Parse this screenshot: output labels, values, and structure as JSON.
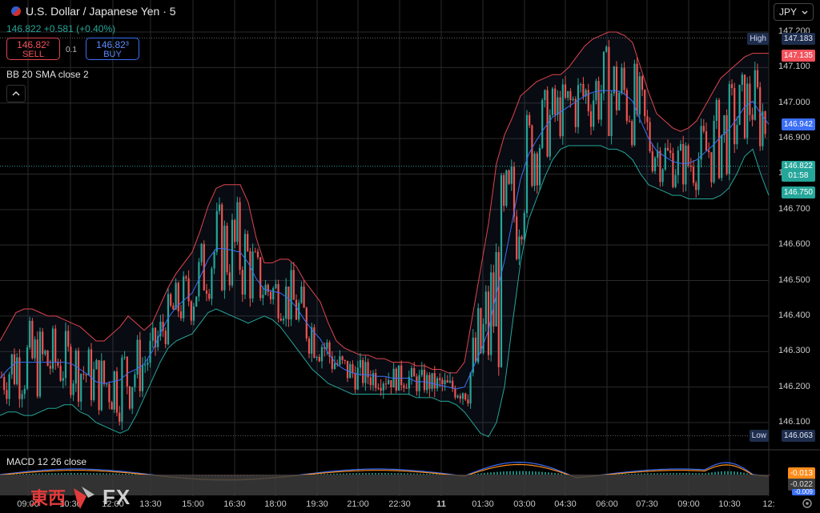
{
  "header": {
    "title": "U.S. Dollar / Japanese Yen · 5",
    "price_change": "146.822 +0.581 (+0.40%)"
  },
  "trade": {
    "sell_price": "146.82²",
    "sell_label": "SELL",
    "spread": "0.1",
    "buy_price": "146.82³",
    "buy_label": "BUY"
  },
  "indicators": {
    "bb_label": "BB 20 SMA close 2",
    "macd_label": "MACD 12 26 close"
  },
  "currency_button": {
    "label": "JPY"
  },
  "price_axis": {
    "ticks": [
      "147.200",
      "147.100",
      "147.000",
      "146.900",
      "146.800",
      "146.700",
      "146.600",
      "146.500",
      "146.400",
      "146.300",
      "146.200",
      "146.100"
    ],
    "high_label": "High",
    "high_value": "147.183",
    "low_label": "Low",
    "low_value": "146.063",
    "bb_upper": "147.135",
    "bb_middle": "146.942",
    "current_price": "146.822",
    "countdown": "01:58",
    "bb_lower": "146.750"
  },
  "macd_axis": {
    "value1": "-0.013",
    "value2": "-0.022",
    "value3": "-0.009"
  },
  "time_axis": {
    "ticks": [
      "09:00",
      "10:30",
      "12:00",
      "13:30",
      "15:00",
      "16:30",
      "18:00",
      "19:30",
      "21:00",
      "22:30",
      "11",
      "01:30",
      "03:00",
      "04:30",
      "06:00",
      "07:30",
      "09:00",
      "10:30",
      "12:"
    ]
  },
  "branding": {
    "kanji": "東西",
    "fx": "FX"
  },
  "colors": {
    "up": "#26a69a",
    "down": "#ef5350",
    "bb_upper": "#e0454f",
    "bb_middle": "#3b6ff5",
    "bb_lower": "#26a69a",
    "macd_line": "#3b6ff5",
    "signal_line": "#ff8c1a"
  },
  "chart_data": {
    "type": "line",
    "title": "U.S. Dollar / Japanese Yen · 5",
    "ylim": [
      146.04,
      147.22
    ],
    "series": [
      {
        "name": "BB 20 SMA close 2",
        "x": [
          0,
          10,
          20,
          30,
          40,
          50,
          60,
          70,
          80,
          90,
          100,
          110,
          120,
          130,
          140,
          150,
          160,
          170,
          180,
          190,
          200,
          210,
          220,
          230,
          240,
          250,
          260,
          270,
          280,
          290,
          300,
          310,
          320,
          330,
          340,
          350,
          360,
          370,
          380,
          390,
          400,
          410,
          420,
          430,
          440,
          450,
          460,
          470,
          480,
          490,
          500,
          510,
          520,
          530,
          540,
          550,
          560,
          570,
          580,
          590,
          600,
          610,
          620,
          630,
          640,
          650,
          660,
          670,
          680,
          690,
          700,
          710,
          720,
          730,
          740,
          750,
          760,
          770,
          780,
          790,
          800,
          810,
          820,
          830,
          840,
          850,
          860,
          870,
          880,
          890,
          900,
          910,
          920,
          930,
          940,
          950,
          960
        ],
        "upper": [
          146.33,
          146.37,
          146.41,
          146.42,
          146.42,
          146.41,
          146.4,
          146.4,
          146.39,
          146.38,
          146.37,
          146.35,
          146.33,
          146.33,
          146.35,
          146.37,
          146.4,
          146.38,
          146.36,
          146.38,
          146.43,
          146.48,
          146.52,
          146.55,
          146.58,
          146.64,
          146.71,
          146.76,
          146.77,
          146.77,
          146.77,
          146.72,
          146.62,
          146.55,
          146.55,
          146.56,
          146.56,
          146.54,
          146.5,
          146.47,
          146.44,
          146.38,
          146.33,
          146.31,
          146.3,
          146.29,
          146.29,
          146.28,
          146.28,
          146.27,
          146.27,
          146.27,
          146.26,
          146.26,
          146.25,
          146.25,
          146.24,
          146.24,
          146.27,
          146.4,
          146.53,
          146.66,
          146.83,
          146.91,
          146.96,
          147.02,
          147.04,
          147.06,
          147.07,
          147.08,
          147.08,
          147.1,
          147.13,
          147.16,
          147.18,
          147.19,
          147.2,
          147.2,
          147.19,
          147.17,
          147.1,
          147.03,
          146.97,
          146.95,
          146.93,
          146.92,
          146.93,
          146.95,
          146.99,
          147.03,
          147.07,
          147.09,
          147.11,
          147.13,
          147.14,
          147.14,
          147.14
        ]
      }
    ]
  }
}
